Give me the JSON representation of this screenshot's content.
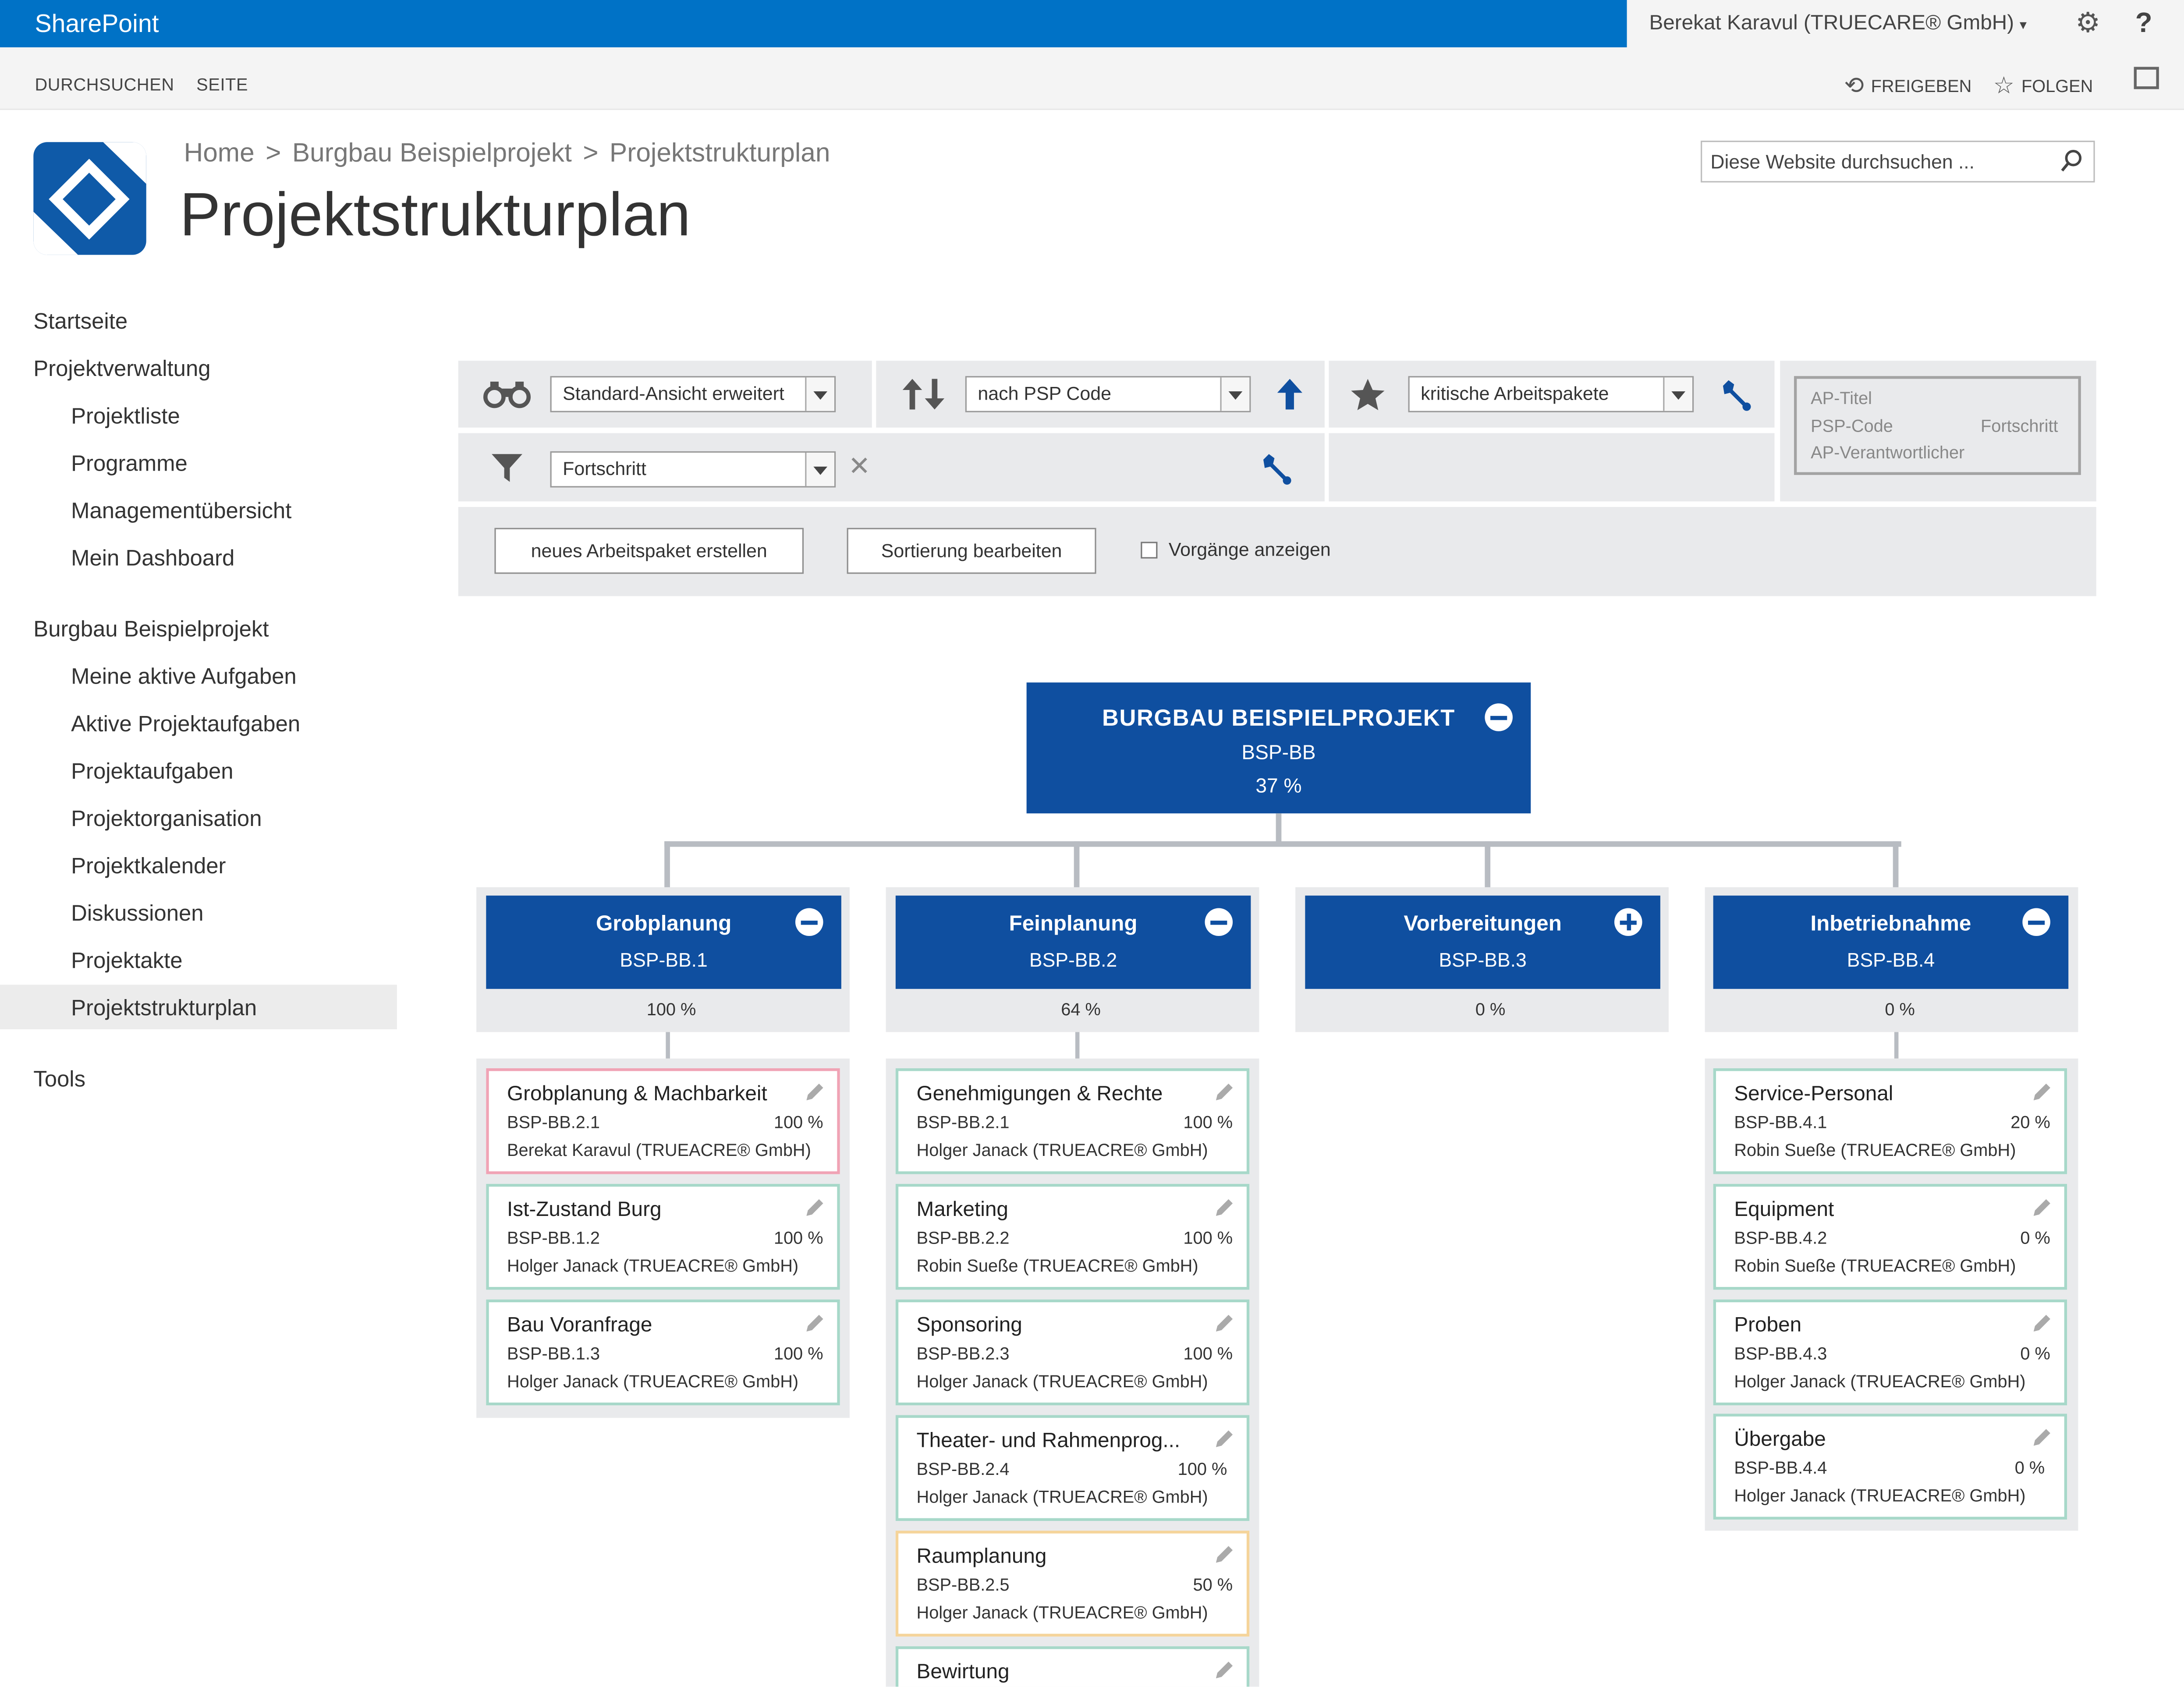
{
  "topbar": {
    "brand": "SharePoint",
    "user": "Berekat Karavul (TRUECARE® GmbH)",
    "user_caret": "▾",
    "settings_glyph": "⚙",
    "help": "?"
  },
  "ribbon": {
    "tab_browse": "DURCHSUCHEN",
    "tab_page": "SEITE",
    "share": "FREIGEBEN",
    "follow": "FOLGEN",
    "share_glyph": "⟲",
    "follow_glyph": "☆"
  },
  "breadcrumb": {
    "home": "Home",
    "project": "Burgbau Beispielprojekt",
    "current": "Projektstrukturplan",
    "sep": ">"
  },
  "page_title": "Projektstrukturplan",
  "search": {
    "placeholder": "Diese Website durchsuchen ..."
  },
  "nav": [
    "Startseite",
    "Projektverwaltung",
    "Projektliste",
    "Programme",
    "Managementübersicht",
    "Mein Dashboard",
    "Burgbau Beispielprojekt",
    "Meine aktive Aufgaben",
    "Aktive Projektaufgaben",
    "Projektaufgaben",
    "Projektorganisation",
    "Projektkalender",
    "Diskussionen",
    "Projektakte",
    "Projektstrukturplan",
    "Tools"
  ],
  "toolbar": {
    "view": "Standard-Ansicht erweitert",
    "sort": "nach PSP Code",
    "highlight": "kritische Arbeitspakete",
    "filter": "Fortschritt",
    "clear_glyph": "✕",
    "new_package": "neues Arbeitspaket erstellen",
    "edit_sort": "Sortierung bearbeiten",
    "show_tasks": "Vorgänge anzeigen",
    "legend": {
      "title": "AP-Titel",
      "code": "PSP-Code",
      "progress": "Fortschritt",
      "owner": "AP-Verantwortlicher"
    }
  },
  "root": {
    "title": "BURGBAU BEISPIELPROJEKT",
    "code": "BSP-BB",
    "progress": "37 %"
  },
  "phases": [
    {
      "title": "Grobplanung",
      "code": "BSP-BB.1",
      "progress": "100 %",
      "items": [
        {
          "title": "Grobplanung & Machbarkeit",
          "code": "BSP-BB.2.1",
          "progress": "100 %",
          "owner": "Berekat Karavul (TRUEACRE® GmbH)"
        },
        {
          "title": "Ist-Zustand Burg",
          "code": "BSP-BB.1.2",
          "progress": "100 %",
          "owner": "Holger Janack (TRUEACRE® GmbH)"
        },
        {
          "title": "Bau Voranfrage",
          "code": "BSP-BB.1.3",
          "progress": "100 %",
          "owner": "Holger Janack (TRUEACRE® GmbH)"
        }
      ]
    },
    {
      "title": "Feinplanung",
      "code": "BSP-BB.2",
      "progress": "64 %",
      "items": [
        {
          "title": "Genehmigungen & Rechte",
          "code": "BSP-BB.2.1",
          "progress": "100 %",
          "owner": "Holger Janack (TRUEACRE® GmbH)"
        },
        {
          "title": "Marketing",
          "code": "BSP-BB.2.2",
          "progress": "100 %",
          "owner": "Robin Sueße  (TRUEACRE® GmbH)"
        },
        {
          "title": "Sponsoring",
          "code": "BSP-BB.2.3",
          "progress": "100 %",
          "owner": "Holger Janack (TRUEACRE® GmbH)"
        },
        {
          "title": "Theater- und Rahmenprog...",
          "code": "BSP-BB.2.4",
          "progress": "100 %",
          "owner": "Holger Janack (TRUEACRE® GmbH)"
        },
        {
          "title": "Raumplanung",
          "code": "BSP-BB.2.5",
          "progress": "50 %",
          "owner": "Holger Janack (TRUEACRE® GmbH)"
        },
        {
          "title": "Bewirtung",
          "code": "",
          "progress": "",
          "owner": ""
        }
      ]
    },
    {
      "title": "Vorbereitungen",
      "code": "BSP-BB.3",
      "progress": "0 %",
      "items": []
    },
    {
      "title": "Inbetriebnahme",
      "code": "BSP-BB.4",
      "progress": "0 %",
      "items": [
        {
          "title": "Service-Personal",
          "code": "BSP-BB.4.1",
          "progress": "20 %",
          "owner": "Robin Sueße  (TRUEACRE® GmbH)"
        },
        {
          "title": "Equipment",
          "code": "BSP-BB.4.2",
          "progress": "0 %",
          "owner": "Robin Sueße  (TRUEACRE® GmbH)"
        },
        {
          "title": "Proben",
          "code": "BSP-BB.4.3",
          "progress": "0 %",
          "owner": "Holger Janack (TRUEACRE® GmbH)"
        },
        {
          "title": "Übergabe",
          "code": "BSP-BB.4.4",
          "progress": "0 %",
          "owner": "Holger Janack (TRUEACRE® GmbH)"
        }
      ]
    }
  ],
  "colors": {
    "brand": "#0072c6",
    "node": "#0f4fa0",
    "ok": "#a7d8c9",
    "critical": "#f0a3b5",
    "warning": "#f5d49a"
  }
}
